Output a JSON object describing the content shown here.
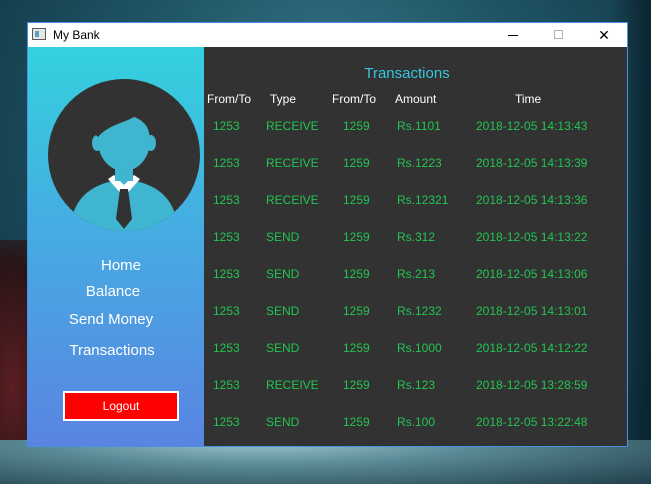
{
  "window": {
    "title": "My Bank",
    "controls": {
      "minimize": "",
      "maximize": "",
      "close": "✕"
    }
  },
  "sidebar": {
    "nav": [
      "Home",
      "Balance",
      "Send Money",
      "Transactions"
    ],
    "logout_label": "Logout"
  },
  "content": {
    "title": "Transactions",
    "headers": [
      "From/To",
      "Type",
      "From/To",
      "Amount",
      "Time"
    ],
    "rows": [
      [
        "1253",
        "RECEIVE",
        "1259",
        "Rs.1101",
        "2018-12-05 14:13:43"
      ],
      [
        "1253",
        "RECEIVE",
        "1259",
        "Rs.1223",
        "2018-12-05 14:13:39"
      ],
      [
        "1253",
        "RECEIVE",
        "1259",
        "Rs.12321",
        "2018-12-05 14:13:36"
      ],
      [
        "1253",
        "SEND",
        "1259",
        "Rs.312",
        "2018-12-05 14:13:22"
      ],
      [
        "1253",
        "SEND",
        "1259",
        "Rs.213",
        "2018-12-05 14:13:06"
      ],
      [
        "1253",
        "SEND",
        "1259",
        "Rs.1232",
        "2018-12-05 14:13:01"
      ],
      [
        "1253",
        "SEND",
        "1259",
        "Rs.1000",
        "2018-12-05 14:12:22"
      ],
      [
        "1253",
        "RECEIVE",
        "1259",
        "Rs.123",
        "2018-12-05 13:28:59"
      ],
      [
        "1253",
        "SEND",
        "1259",
        "Rs.100",
        "2018-12-05 13:22:48"
      ]
    ]
  },
  "colors": {
    "sidebar_top": "#34d1de",
    "sidebar_bottom": "#5a84e2",
    "content_bg": "#323232",
    "accent_title": "#35c6dc",
    "row_text": "#23c552",
    "logout_bg": "#ff0000"
  }
}
